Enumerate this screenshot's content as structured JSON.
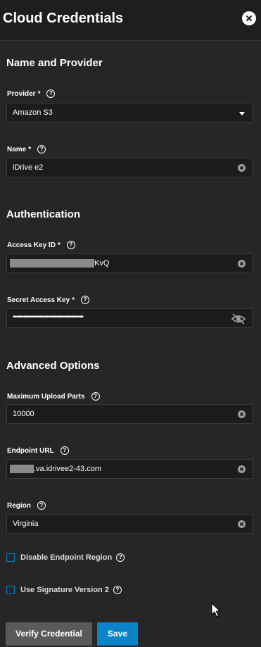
{
  "header": {
    "title": "Cloud Credentials"
  },
  "sections": {
    "name_provider": "Name and Provider",
    "authentication": "Authentication",
    "advanced": "Advanced Options"
  },
  "fields": {
    "provider": {
      "label": "Provider",
      "value": "Amazon S3"
    },
    "name": {
      "label": "Name",
      "value": "iDrive e2"
    },
    "access_key": {
      "label": "Access Key ID",
      "value_suffix": "KvQ"
    },
    "secret_key": {
      "label": "Secret Access Key",
      "value": "••••••••••••••••••••••••••••••••••••••••"
    },
    "max_upload_parts": {
      "label": "Maximum Upload Parts",
      "value": "10000"
    },
    "endpoint_url": {
      "label": "Endpoint URL",
      "value_suffix": ".va.idrivee2-43.com"
    },
    "region": {
      "label": "Region",
      "value": "Virginia"
    }
  },
  "required_marker": "*",
  "help_glyph": "?",
  "checkboxes": {
    "disable_endpoint_region": {
      "label": "Disable Endpoint Region",
      "checked": false
    },
    "signature_v2": {
      "label": "Use Signature Version 2",
      "checked": false
    }
  },
  "buttons": {
    "verify": "Verify Credential",
    "save": "Save"
  },
  "colors": {
    "accent": "#0a84c9",
    "background": "#262626",
    "input_bg": "#1c1c1c"
  }
}
